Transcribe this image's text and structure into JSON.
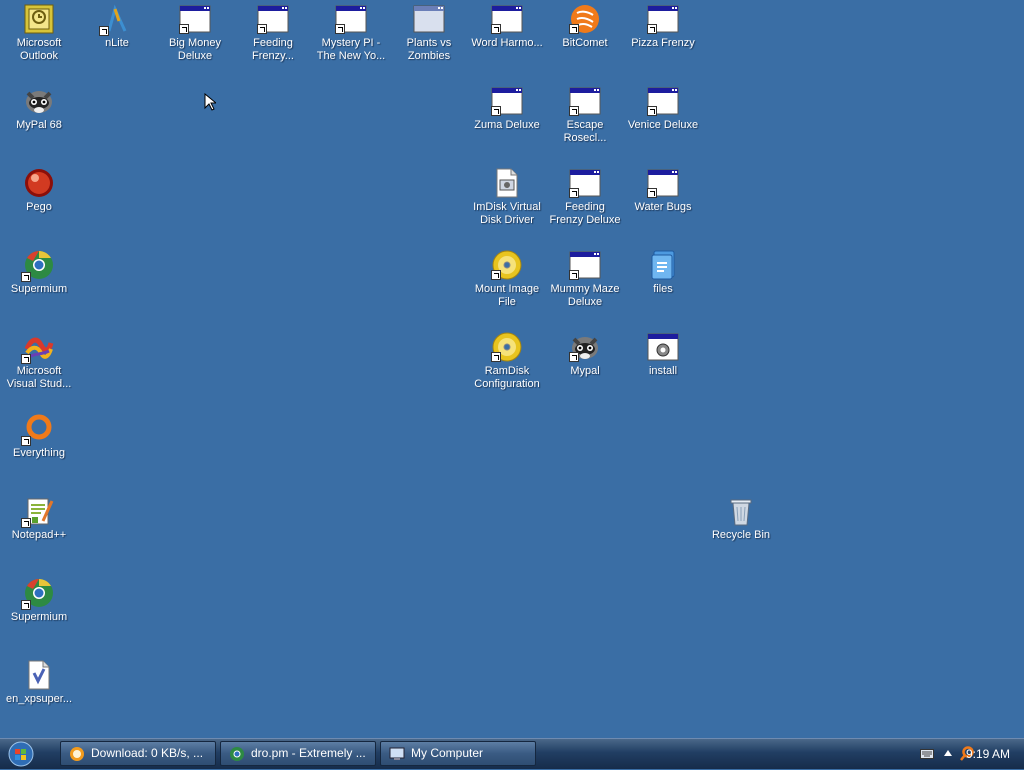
{
  "desktop_icons": [
    {
      "label": "Microsoft Outlook",
      "icon": "outlook-icon"
    },
    {
      "label": "nLite",
      "icon": "nlite-icon"
    },
    {
      "label": "Big Money Deluxe",
      "icon": "window-app-icon"
    },
    {
      "label": "Feeding Frenzy...",
      "icon": "window-app-icon"
    },
    {
      "label": "Mystery PI - The New Yo...",
      "icon": "window-app-icon"
    },
    {
      "label": "Plants vs Zombies",
      "icon": "window-app-icon"
    },
    {
      "label": "Word Harmo...",
      "icon": "window-app-icon"
    },
    {
      "label": "BitComet",
      "icon": "bitcomet-icon"
    },
    {
      "label": "Pizza Frenzy",
      "icon": "window-app-icon"
    },
    {
      "label": "MyPal 68",
      "icon": "raccoon-icon"
    },
    {
      "label": "Zuma Deluxe",
      "icon": "window-app-icon"
    },
    {
      "label": "Escape Rosecl...",
      "icon": "window-app-icon"
    },
    {
      "label": "Venice Deluxe",
      "icon": "window-app-icon"
    },
    {
      "label": "Pego",
      "icon": "pego-icon"
    },
    {
      "label": "ImDisk Virtual Disk Driver",
      "icon": "settings-file-icon"
    },
    {
      "label": "Feeding Frenzy Deluxe",
      "icon": "window-app-icon"
    },
    {
      "label": "Water Bugs",
      "icon": "window-app-icon"
    },
    {
      "label": "Supermium",
      "icon": "supermium-icon"
    },
    {
      "label": "Mount Image File",
      "icon": "cd-icon"
    },
    {
      "label": "Mummy Maze Deluxe",
      "icon": "window-app-icon"
    },
    {
      "label": "files",
      "icon": "files-icon"
    },
    {
      "label": "Microsoft Visual Stud...",
      "icon": "visual-studio-icon"
    },
    {
      "label": "RamDisk Configuration",
      "icon": "cd-icon"
    },
    {
      "label": "Mypal",
      "icon": "raccoon-icon"
    },
    {
      "label": "install",
      "icon": "install-gear-icon"
    },
    {
      "label": "Everything",
      "icon": "everything-icon"
    },
    {
      "label": "Notepad++",
      "icon": "notepad-icon"
    },
    {
      "label": "Recycle Bin",
      "icon": "recycle-bin-icon"
    },
    {
      "label": "Supermium",
      "icon": "supermium-icon"
    },
    {
      "label": "en_xpsuper...",
      "icon": "document-icon"
    }
  ],
  "taskbar": {
    "start_icon": "windows-orb-icon",
    "tasks": [
      {
        "label": "Download: 0 KB/s, ...",
        "icon": "firefox-icon"
      },
      {
        "label": "dro.pm - Extremely ...",
        "icon": "supermium-icon"
      },
      {
        "label": "My Computer",
        "icon": "my-computer-icon"
      }
    ],
    "tray": {
      "icons": [
        "keyboard-icon",
        "tray-up-arrow-icon",
        "search-tray-icon"
      ],
      "clock": "9:19 AM"
    }
  },
  "colors": {
    "desktop": "#3a6ea5",
    "taskbar": "#213e63"
  }
}
